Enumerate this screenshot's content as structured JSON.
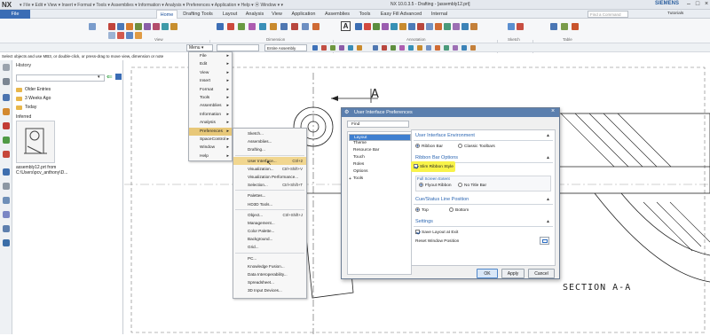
{
  "app": {
    "logo": "NX",
    "quick_access": "▾ 𝔽ile ▾ Edit ▾ View ▾ Insert ▾ Format ▾ Tools ▾ Assemblies ▾ Information ▾ Analysis ▾ Preferences ▾ Application ▾ Help ▾ ⦿ Window ▾ ▾",
    "window_title": "NX 10.0.3.5 - Drafting - [assembly12.prt]",
    "brand": "SIEMENS",
    "window_controls": [
      "–",
      "□",
      "×"
    ]
  },
  "ribbon": {
    "file_tab": "File",
    "tabs": [
      "Home",
      "Drafting Tools",
      "Layout",
      "Analysis",
      "View",
      "Application",
      "Assemblies",
      "Tools",
      "Easy Fill Advanced",
      "Internal"
    ],
    "active_tab": "Home",
    "find_placeholder": "Find a Command",
    "tutorials": "Tutorials",
    "group_labels": [
      "View",
      "Dimension",
      "Annotation",
      "Sketch",
      "Table"
    ]
  },
  "toolbar": {
    "menu_label": "Menu ▾",
    "filter_value": "Entire Assembly"
  },
  "status_text": "Select objects and use MB3, or double-click, or press-drag to move view, dimension or note",
  "nav_panel": {
    "title": "History",
    "folders": [
      "Older Entries",
      "3 Weeks Ago",
      "Today"
    ],
    "group": "Inferred",
    "file_caption": "assembly12.prt from C:\\Users\\pcv_anthony\\D..."
  },
  "main_menu": {
    "items": [
      {
        "label": "File",
        "arrow": true
      },
      {
        "label": "Edit",
        "arrow": true
      },
      {
        "label": "View",
        "arrow": true
      },
      {
        "label": "Insert",
        "arrow": true
      },
      {
        "label": "Format",
        "arrow": true
      },
      {
        "label": "Tools",
        "arrow": true
      },
      {
        "label": "Assemblies",
        "arrow": true
      },
      {
        "label": "Information",
        "arrow": true
      },
      {
        "label": "Analysis",
        "arrow": true
      },
      {
        "label": "Preferences",
        "arrow": true,
        "highlight": true
      },
      {
        "label": "SpaceControl",
        "arrow": true
      },
      {
        "label": "Window",
        "arrow": true
      },
      {
        "label": "Help",
        "arrow": true
      }
    ]
  },
  "pref_menu": {
    "items": [
      {
        "label": "Sketch..."
      },
      {
        "label": "Assemblies..."
      },
      {
        "label": "Drafting..."
      },
      {
        "sep": true
      },
      {
        "label": "User Interface...",
        "shortcut": "Ctrl+2",
        "highlight": true
      },
      {
        "label": "Visualization...",
        "shortcut": "Ctrl+Shift+V"
      },
      {
        "label": "Visualization Performance..."
      },
      {
        "label": "Selection...",
        "shortcut": "Ctrl+Shift+T"
      },
      {
        "sep": true
      },
      {
        "label": "Palettes..."
      },
      {
        "label": "HD3D Tools..."
      },
      {
        "sep": true
      },
      {
        "label": "Object...",
        "shortcut": "Ctrl+Shift+J"
      },
      {
        "label": "Management..."
      },
      {
        "label": "Color Palette..."
      },
      {
        "label": "Background..."
      },
      {
        "label": "Grid..."
      },
      {
        "sep": true
      },
      {
        "label": "PC..."
      },
      {
        "label": "Knowledge Fusion..."
      },
      {
        "label": "Data Interoperability..."
      },
      {
        "label": "Spreadsheet..."
      },
      {
        "label": "3D Input Devices..."
      }
    ]
  },
  "dialog": {
    "title": "User Interface Preferences",
    "find_label": "Find",
    "tree": [
      "Layout",
      "Theme",
      "Resource Bar",
      "Touch",
      "Roles",
      "Options",
      "Tools"
    ],
    "sections": {
      "env_title": "User Interface Environment",
      "env_opt1": "Ribbon Bar",
      "env_opt2": "Classic Toolbars",
      "ribbon_title": "Ribbon Bar Options",
      "slim_label": "Slim Ribbon Style",
      "fullscreen_title": "Full Screen Extent",
      "fs_opt1": "Flyout Ribbon",
      "fs_opt2": "No Title Bar",
      "cue_title": "Cue/Status Line Position",
      "cue_opt1": "Top",
      "cue_opt2": "Bottom",
      "settings_title": "Settings",
      "save_layout": "Save Layout at Exit",
      "reset_layout": "Reset Window Position"
    },
    "buttons": {
      "ok": "OK",
      "apply": "Apply",
      "cancel": "Cancel"
    }
  },
  "drawing": {
    "label_a": "A",
    "section_label": "SECTION A-A"
  },
  "colors": {
    "accent": "#3a6db5",
    "menu_highlight": "#e8c879",
    "slim_highlight": "#f8f34a",
    "dialog_title": "#5b7fae"
  }
}
